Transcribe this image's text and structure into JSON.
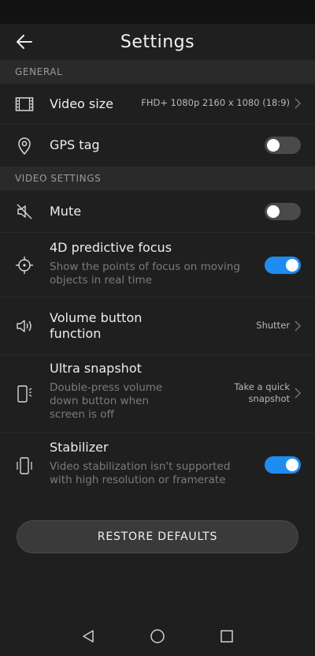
{
  "header": {
    "title": "Settings"
  },
  "sections": {
    "general": "GENERAL",
    "video": "VIDEO SETTINGS"
  },
  "rows": {
    "video_size": {
      "label": "Video size",
      "value": "FHD+ 1080p 2160 x 1080 (18:9)"
    },
    "gps_tag": {
      "label": "GPS tag",
      "enabled": false
    },
    "mute": {
      "label": "Mute",
      "enabled": false
    },
    "predictive_focus": {
      "label": "4D predictive focus",
      "desc1": "Show the points of focus on moving",
      "desc2": "objects in real time",
      "enabled": true
    },
    "volume_button": {
      "label1": "Volume button",
      "label2": "function",
      "value": "Shutter"
    },
    "ultra_snapshot": {
      "label": "Ultra snapshot",
      "desc1": "Double-press volume",
      "desc2": "down button when",
      "desc3": "screen is off",
      "value1": "Take a quick",
      "value2": "snapshot"
    },
    "stabilizer": {
      "label": "Stabilizer",
      "desc1": "Video stabilization isn't supported",
      "desc2": "with high resolution or framerate",
      "enabled": true
    }
  },
  "restore_label": "RESTORE DEFAULTS",
  "colors": {
    "accent": "#1e8cf0",
    "background": "#1f1f1f",
    "section": "#2a2a2a"
  },
  "icons": {
    "back": "arrow-left-icon",
    "video_size": "film-frame-icon",
    "gps": "location-pin-icon",
    "mute": "speaker-muted-icon",
    "focus": "crosshair-icon",
    "volume": "speaker-icon",
    "snapshot": "phone-snapshot-icon",
    "stabilizer": "phone-vibrate-icon",
    "nav_back": "triangle-back-icon",
    "nav_home": "circle-home-icon",
    "nav_recent": "square-recent-icon"
  }
}
